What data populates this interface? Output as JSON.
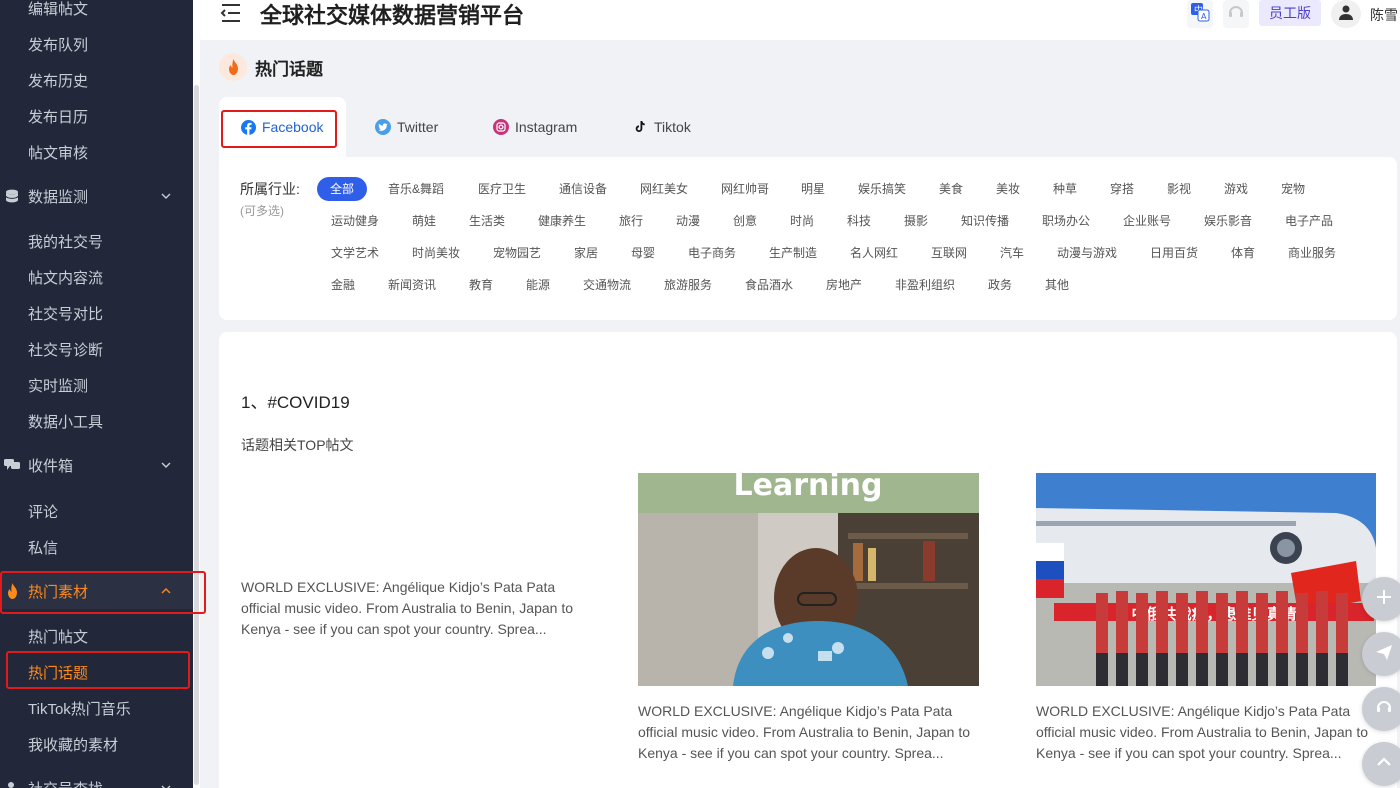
{
  "header": {
    "title": "全球社交媒体数据营销平台",
    "staff_badge": "员工版",
    "user_name": "陈雪"
  },
  "sidebar": {
    "items": [
      {
        "label": "编辑帖文",
        "type": "sub"
      },
      {
        "label": "发布队列",
        "type": "sub"
      },
      {
        "label": "发布历史",
        "type": "sub"
      },
      {
        "label": "发布日历",
        "type": "sub"
      },
      {
        "label": "帖文审核",
        "type": "sub"
      },
      {
        "label": "数据监测",
        "type": "group",
        "icon": "database-icon",
        "expanded": true
      },
      {
        "label": "我的社交号",
        "type": "sub"
      },
      {
        "label": "帖文内容流",
        "type": "sub"
      },
      {
        "label": "社交号对比",
        "type": "sub"
      },
      {
        "label": "社交号诊断",
        "type": "sub"
      },
      {
        "label": "实时监测",
        "type": "sub"
      },
      {
        "label": "数据小工具",
        "type": "sub"
      },
      {
        "label": "收件箱",
        "type": "group",
        "icon": "message-icon",
        "expanded": true
      },
      {
        "label": "评论",
        "type": "sub"
      },
      {
        "label": "私信",
        "type": "sub"
      },
      {
        "label": "热门素材",
        "type": "group",
        "icon": "fire-icon",
        "expanded": true,
        "active": true
      },
      {
        "label": "热门帖文",
        "type": "sub"
      },
      {
        "label": "热门话题",
        "type": "sub",
        "active": true
      },
      {
        "label": "TikTok热门音乐",
        "type": "sub"
      },
      {
        "label": "我收藏的素材",
        "type": "sub"
      },
      {
        "label": "社交号查找",
        "type": "group",
        "icon": "search-user-icon",
        "expanded": false
      }
    ]
  },
  "page": {
    "title": "热门话题",
    "tabs": [
      {
        "label": "Facebook",
        "icon": "facebook-icon",
        "active": true
      },
      {
        "label": "Twitter",
        "icon": "twitter-icon"
      },
      {
        "label": "Instagram",
        "icon": "instagram-icon"
      },
      {
        "label": "Tiktok",
        "icon": "tiktok-icon"
      }
    ]
  },
  "filter": {
    "label": "所属行业:",
    "hint": "(可多选)",
    "selected": "全部",
    "rows": [
      [
        "全部",
        "音乐&舞蹈",
        "医疗卫生",
        "通信设备",
        "网红美女",
        "网红帅哥",
        "明星",
        "娱乐搞笑",
        "美食",
        "美妆",
        "种草",
        "穿搭",
        "影视",
        "游戏",
        "宠物"
      ],
      [
        "运动健身",
        "萌娃",
        "生活类",
        "健康养生",
        "旅行",
        "动漫",
        "创意",
        "时尚",
        "科技",
        "摄影",
        "知识传播",
        "职场办公",
        "企业账号",
        "娱乐影音",
        "电子产品"
      ],
      [
        "文学艺术",
        "时尚美妆",
        "宠物园艺",
        "家居",
        "母婴",
        "电子商务",
        "生产制造",
        "名人网红",
        "互联网",
        "汽车",
        "动漫与游戏",
        "日用百货",
        "体育",
        "商业服务"
      ],
      [
        "金融",
        "新闻资讯",
        "教育",
        "能源",
        "交通物流",
        "旅游服务",
        "食品酒水",
        "房地产",
        "非盈利组织",
        "政务",
        "其他"
      ]
    ]
  },
  "topic": {
    "title": "1、#COVID19",
    "subtitle": "话题相关TOP帖文",
    "posts": [
      {
        "text": "WORLD EXCLUSIVE: Angélique Kidjo’s Pata Pata official music video. From Australia to Benin, Japan to Kenya - see if you can spot your country. Sprea...",
        "has_image": false
      },
      {
        "text": "WORLD EXCLUSIVE: Angélique Kidjo’s Pata Pata official music video. From Australia to Benin, Japan to Kenya - see if you can spot your country. Sprea...",
        "has_image": true,
        "image_caption": "Learning"
      },
      {
        "text": "WORLD EXCLUSIVE: Angélique Kidjo’s Pata Pata official music video. From Australia to Benin, Japan to Kenya - see if you can spot your country. Sprea...",
        "has_image": true,
        "image_caption": "中俄共战疫，患难见真情"
      }
    ]
  },
  "colors": {
    "sidebar_bg": "#22283a",
    "accent_orange": "#ff8a1a",
    "primary_blue": "#2f5fe8",
    "highlight_red": "#e21a1a"
  },
  "fabs": [
    "plus-icon",
    "send-icon",
    "headset-icon",
    "chevron-up-icon"
  ]
}
